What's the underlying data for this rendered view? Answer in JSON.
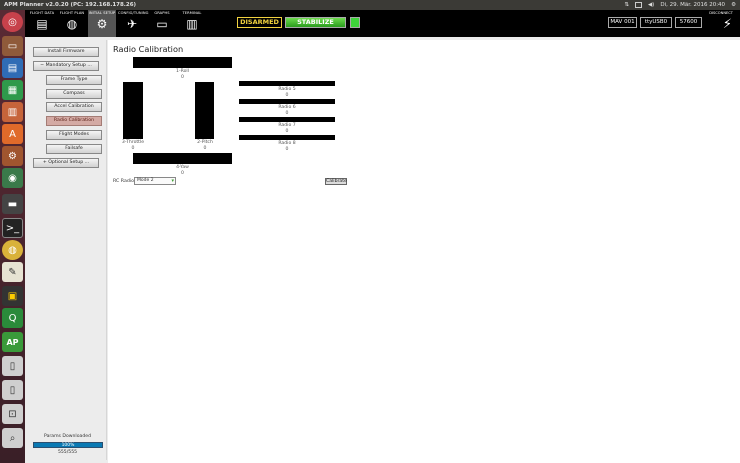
{
  "topbar": {
    "title": "APM Planner v2.0.20 (PC: 192.168.178.26)",
    "datetime": "Di, 29. Mär. 2016 20:40"
  },
  "toolbar": {
    "items": [
      {
        "label": "FLIGHT DATA",
        "icon": "chart-icon"
      },
      {
        "label": "FLIGHT PLAN",
        "icon": "globe-icon"
      },
      {
        "label": "INITIAL SETUP",
        "icon": "gear-icon"
      },
      {
        "label": "CONFIG/TUNING",
        "icon": "wrench-icon"
      },
      {
        "label": "GRAPHS",
        "icon": "monitor-icon"
      },
      {
        "label": "TERMINAL",
        "icon": "document-icon"
      }
    ],
    "armed": "DISARMED",
    "mode": "STABILIZE",
    "mav": "MAV 001",
    "port": "ttyUSB0",
    "baud": "57600",
    "disconnect": "DISCONNECT"
  },
  "sidebar": {
    "install_firmware": "Install Firmware",
    "mandatory_setup": "− Mandatory Setup ...",
    "frame_type": "Frame Type",
    "compass": "Compass",
    "accel_calibration": "Accel Calibration",
    "radio_calibration": "Radio Calibration",
    "flight_modes": "Flight Modes",
    "failsafe": "Failsafe",
    "optional_setup": "+ Optional Setup ...",
    "params_label": "Params Downloaded",
    "params_progress": "100%",
    "params_progress_value": 100,
    "params_count": "555/555"
  },
  "content": {
    "title": "Radio Calibration",
    "roll": {
      "label": "1-Roll",
      "value": "0"
    },
    "pitch": {
      "label": "2-Pitch",
      "value": "0"
    },
    "throttle": {
      "label": "3-Throttle",
      "value": "0"
    },
    "yaw": {
      "label": "4-Yaw",
      "value": "0"
    },
    "radio5": {
      "label": "Radio 5",
      "value": "0"
    },
    "radio6": {
      "label": "Radio 6",
      "value": "0"
    },
    "radio7": {
      "label": "Radio 7",
      "value": "0"
    },
    "radio8": {
      "label": "Radio 8",
      "value": "0"
    },
    "rc_radio_label": "RC Radio",
    "rc_mode": "Mode 2",
    "calibrate": "Calibrate"
  },
  "colors": {
    "armed": "#f1d23f",
    "mode": "#2a9d1e",
    "active_item": "#d4aaa4",
    "progress": "#0a79b3"
  }
}
